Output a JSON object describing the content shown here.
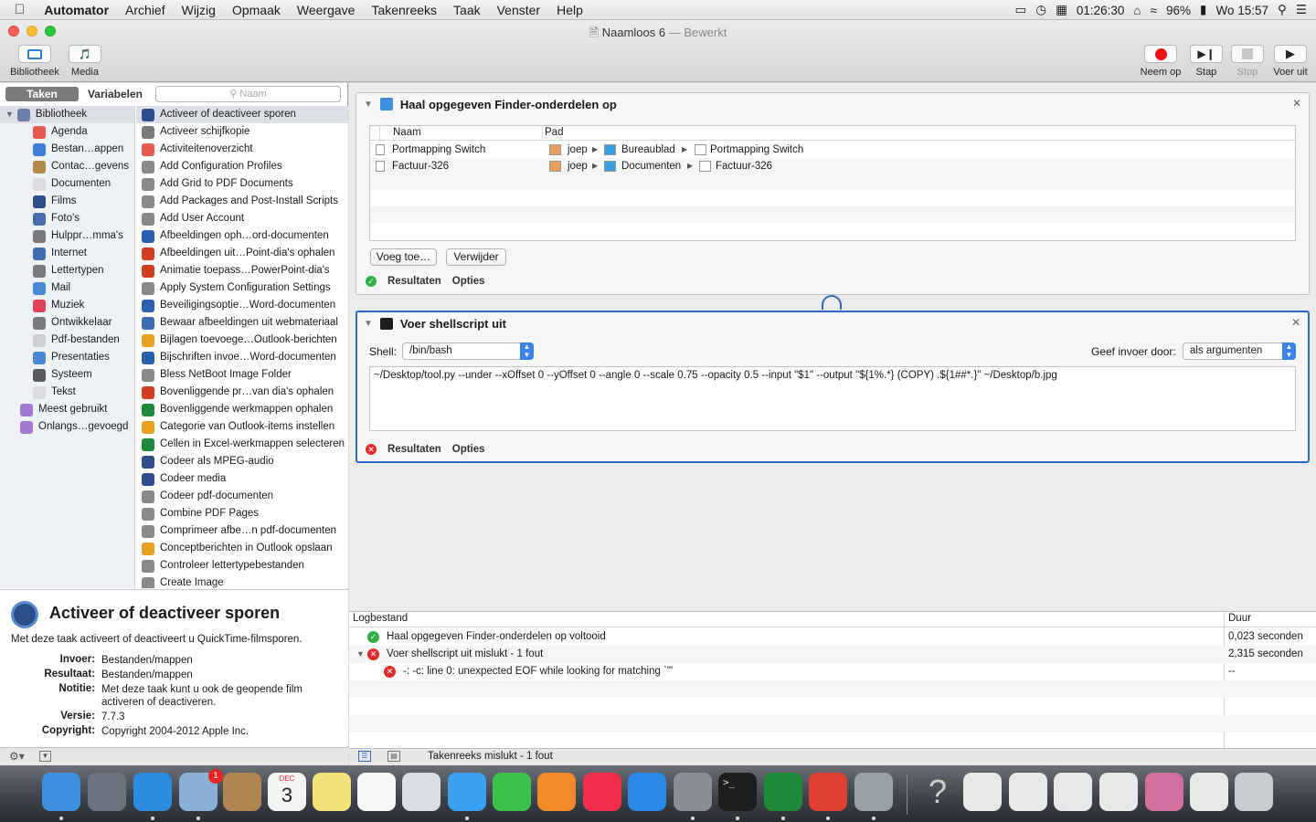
{
  "menubar": {
    "apple": "",
    "app": "Automator",
    "items": [
      "Archief",
      "Wijzig",
      "Opmaak",
      "Weergave",
      "Takenreeks",
      "Taak",
      "Venster",
      "Help"
    ],
    "timer": "01:26:30",
    "battery": "96%",
    "clock": "Wo 15:57"
  },
  "window": {
    "title": "Naamloos 6",
    "status": "Bewerkt"
  },
  "toolbar": {
    "left": [
      "Bibliotheek",
      "Media"
    ],
    "right": [
      "Neem op",
      "Stap",
      "Stop",
      "Voer uit"
    ]
  },
  "leftpanel": {
    "tabs": [
      "Taken",
      "Variabelen"
    ],
    "search_placeholder": "Naam",
    "library": [
      {
        "label": "Bibliotheek",
        "color": "#6b7fa8"
      },
      {
        "label": "Agenda",
        "color": "#e45a4e"
      },
      {
        "label": "Bestan…appen",
        "color": "#3d7fd6"
      },
      {
        "label": "Contac…gevens",
        "color": "#b08a4a"
      },
      {
        "label": "Documenten",
        "color": "#dcdcdc"
      },
      {
        "label": "Films",
        "color": "#2c4e8a"
      },
      {
        "label": "Foto's",
        "color": "#4a6fa8"
      },
      {
        "label": "Hulppr…mma's",
        "color": "#7a7a7a"
      },
      {
        "label": "Internet",
        "color": "#3d6fb0"
      },
      {
        "label": "Lettertypen",
        "color": "#7a7a7a"
      },
      {
        "label": "Mail",
        "color": "#4a8ad4"
      },
      {
        "label": "Muziek",
        "color": "#e0425a"
      },
      {
        "label": "Ontwikkelaar",
        "color": "#7a7a7a"
      },
      {
        "label": "Pdf-bestanden",
        "color": "#cfcfcf"
      },
      {
        "label": "Presentaties",
        "color": "#4a8ad4"
      },
      {
        "label": "Systeem",
        "color": "#5a5a5a"
      },
      {
        "label": "Tekst",
        "color": "#dcdcdc"
      },
      {
        "label": "Meest gebruikt",
        "color": "#a07ad0"
      },
      {
        "label": "Onlangs…gevoegd",
        "color": "#a07ad0"
      }
    ],
    "actions": [
      {
        "label": "Activeer of deactiveer sporen",
        "color": "#2c4e8a"
      },
      {
        "label": "Activeer schijfkopie",
        "color": "#7a7a7a"
      },
      {
        "label": "Activiteitenoverzicht",
        "color": "#e45a4e"
      },
      {
        "label": "Add Configuration Profiles",
        "color": "#8a8a8a"
      },
      {
        "label": "Add Grid to PDF Documents",
        "color": "#8a8a8a"
      },
      {
        "label": "Add Packages and Post-Install Scripts",
        "color": "#8a8a8a"
      },
      {
        "label": "Add User Account",
        "color": "#8a8a8a"
      },
      {
        "label": "Afbeeldingen oph…ord-documenten",
        "color": "#2b5fb0"
      },
      {
        "label": "Afbeeldingen uit…Point-dia's ophalen",
        "color": "#d04020"
      },
      {
        "label": "Animatie toepass…PowerPoint-dia's",
        "color": "#d04020"
      },
      {
        "label": "Apply System Configuration Settings",
        "color": "#8a8a8a"
      },
      {
        "label": "Beveiligingsoptie…Word-documenten",
        "color": "#2b5fb0"
      },
      {
        "label": "Bewaar afbeeldingen uit webmateriaal",
        "color": "#3d6fb0"
      },
      {
        "label": "Bijlagen toevoege…Outlook-berichten",
        "color": "#e8a020"
      },
      {
        "label": "Bijschriften invoe…Word-documenten",
        "color": "#2b5fb0"
      },
      {
        "label": "Bless NetBoot Image Folder",
        "color": "#8a8a8a"
      },
      {
        "label": "Bovenliggende pr…van dia's ophalen",
        "color": "#d04020"
      },
      {
        "label": "Bovenliggende werkmappen ophalen",
        "color": "#1f8a3a"
      },
      {
        "label": "Categorie van Outlook-items instellen",
        "color": "#e8a020"
      },
      {
        "label": "Cellen in Excel-werkmappen selecteren",
        "color": "#1f8a3a"
      },
      {
        "label": "Codeer als MPEG-audio",
        "color": "#2c4e8a"
      },
      {
        "label": "Codeer media",
        "color": "#2c4e8a"
      },
      {
        "label": "Codeer pdf-documenten",
        "color": "#8a8a8a"
      },
      {
        "label": "Combine PDF Pages",
        "color": "#8a8a8a"
      },
      {
        "label": "Comprimeer afbe…n pdf-documenten",
        "color": "#8a8a8a"
      },
      {
        "label": "Conceptberichten in Outlook opslaan",
        "color": "#e8a020"
      },
      {
        "label": "Controleer lettertypebestanden",
        "color": "#8a8a8a"
      },
      {
        "label": "Create Image",
        "color": "#8a8a8a"
      }
    ],
    "description": {
      "title": "Activeer of deactiveer sporen",
      "summary": "Met deze taak activeert of deactiveert u QuickTime-filmsporen.",
      "fields": [
        {
          "k": "Invoer:",
          "v": "Bestanden/mappen"
        },
        {
          "k": "Resultaat:",
          "v": "Bestanden/mappen"
        },
        {
          "k": "Notitie:",
          "v": "Met deze taak kunt u ook de geopende film activeren of deactiveren."
        },
        {
          "k": "Versie:",
          "v": "7.7.3"
        },
        {
          "k": "Copyright:",
          "v": "Copyright 2004-2012 Apple Inc."
        }
      ]
    }
  },
  "action1": {
    "title": "Haal opgegeven Finder-onderdelen op",
    "col_name": "Naam",
    "col_path": "Pad",
    "rows": [
      {
        "name": "Portmapping Switch",
        "path": [
          "joep",
          "Bureaublad",
          "Portmapping Switch"
        ]
      },
      {
        "name": "Factuur-326",
        "path": [
          "joep",
          "Documenten",
          "Factuur-326"
        ]
      }
    ],
    "add": "Voeg toe…",
    "remove": "Verwijder",
    "results": "Resultaten",
    "options": "Opties"
  },
  "action2": {
    "title": "Voer shellscript uit",
    "shell_label": "Shell:",
    "shell_value": "/bin/bash",
    "input_label": "Geef invoer door:",
    "input_value": "als argumenten",
    "script": "~/Desktop/tool.py --under --xOffset 0 --yOffset 0 --angle 0 --scale 0.75 --opacity 0.5 --input \"$1\" --output \"${1%.*} (COPY) .${1##*.}\" ~/Desktop/b.jpg",
    "results": "Resultaten",
    "options": "Opties"
  },
  "log": {
    "col_log": "Logbestand",
    "col_dur": "Duur",
    "rows": [
      {
        "text": "Haal opgegeven Finder-onderdelen op voltooid",
        "dur": "0,023 seconden",
        "status": "ok"
      },
      {
        "text": "Voer shellscript uit mislukt - 1 fout",
        "dur": "2,315 seconden",
        "status": "err"
      },
      {
        "text": "-: -c: line 0: unexpected EOF while looking for matching `\"'",
        "dur": "--",
        "status": "err"
      }
    ],
    "footer": "Takenreeks mislukt - 1 fout"
  },
  "dock": {
    "calendar_month": "DEC",
    "calendar_day": "3",
    "mail_badge": "1",
    "apps": [
      {
        "name": "finder",
        "color": "#3d8fe0"
      },
      {
        "name": "launchpad",
        "color": "#6a7480"
      },
      {
        "name": "safari",
        "color": "#2d8be0"
      },
      {
        "name": "mail",
        "color": "#8ab0d8"
      },
      {
        "name": "contacts",
        "color": "#b08550"
      },
      {
        "name": "calendar",
        "color": "#f4f4f4"
      },
      {
        "name": "notes",
        "color": "#f3e27a"
      },
      {
        "name": "reminders",
        "color": "#f6f6f6"
      },
      {
        "name": "preview",
        "color": "#d8dde6"
      },
      {
        "name": "messages",
        "color": "#3aa0f0"
      },
      {
        "name": "facetime",
        "color": "#3ac24a"
      },
      {
        "name": "ibooks",
        "color": "#f28a2a"
      },
      {
        "name": "itunes",
        "color": "#f0304a"
      },
      {
        "name": "appstore",
        "color": "#2a8ae8"
      },
      {
        "name": "systempreferences",
        "color": "#8a8e94"
      },
      {
        "name": "terminal",
        "color": "#1e1e1e"
      },
      {
        "name": "excel",
        "color": "#1f8a3a"
      },
      {
        "name": "remotedesktop",
        "color": "#e04030"
      },
      {
        "name": "automator",
        "color": "#9aa0a8"
      },
      {
        "name": "help",
        "color": "#5a5e64"
      },
      {
        "name": "document1",
        "color": "#e8e8e8"
      },
      {
        "name": "document2",
        "color": "#e8e8e8"
      },
      {
        "name": "document3",
        "color": "#e8e8e8"
      },
      {
        "name": "document4",
        "color": "#e8e8e8"
      },
      {
        "name": "document5",
        "color": "#d070a0"
      },
      {
        "name": "document6",
        "color": "#e8e8e8"
      },
      {
        "name": "trash",
        "color": "#c8ccd0"
      }
    ]
  },
  "colors": {
    "selection": "#dcdfe5",
    "accent": "#2d68c4",
    "error": "#e02b2b",
    "ok": "#2fae43"
  }
}
